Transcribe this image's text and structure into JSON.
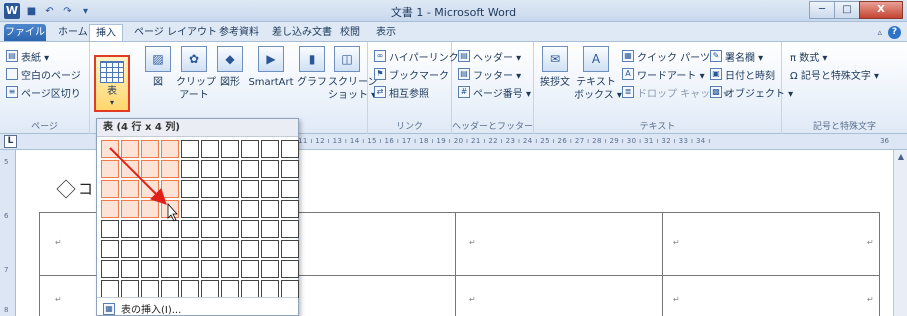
{
  "window": {
    "title": "文書 1 - Microsoft Word",
    "qat_icons": [
      "word-app-icon",
      "save-icon",
      "undo-icon",
      "redo-icon",
      "customize-qat-icon"
    ],
    "controls": [
      "─",
      "□",
      "X"
    ]
  },
  "tabs": [
    {
      "label": "ファイル"
    },
    {
      "label": "ホーム"
    },
    {
      "label": "挿入",
      "active": true
    },
    {
      "label": "ページ レイアウト"
    },
    {
      "label": "参考資料"
    },
    {
      "label": "差し込み文書"
    },
    {
      "label": "校閲"
    },
    {
      "label": "表示"
    }
  ],
  "ribbon": {
    "pages": {
      "label": "ページ",
      "items": [
        "表紙 ▾",
        "空白のページ",
        "ページ区切り"
      ]
    },
    "table": {
      "button_label": "表",
      "dropdown_caret": "▾"
    },
    "illustrations": {
      "items": [
        "図",
        "クリップ\nアート",
        "図形",
        "SmartArt",
        "グラフ",
        "スクリーン\nショット ▾"
      ]
    },
    "links": {
      "label": "リンク",
      "items": [
        "ハイパーリンク",
        "ブックマーク",
        "相互参照"
      ]
    },
    "header_footer": {
      "label": "ヘッダーとフッター",
      "items": [
        "ヘッダー ▾",
        "フッター ▾",
        "ページ番号 ▾"
      ]
    },
    "text": {
      "label": "テキスト",
      "greeting": "挨拶文",
      "textbox": "テキスト\nボックス ▾",
      "items": [
        "クイック パーツ ▾",
        "ワードアート ▾",
        "ドロップ キャップ ▾",
        "署名欄 ▾",
        "日付と時刻",
        "オブジェクト ▾"
      ]
    },
    "symbols": {
      "label": "記号と特殊文字",
      "items": [
        "π 数式 ▾",
        "Ω 記号と特殊文字 ▾"
      ]
    }
  },
  "ruler": {
    "tab_marker": "L",
    "scale_text": "11 ı 12 ı 13 ı 14 ı 15 ı 16 ı 17 ı 18 ı 19 ı 20 ı 21 ı 22 ı 23 ı 24 ı 25 ı 26 ı 27 ı 28 ı 29 ı 30 ı 31 ı 32 ı 33 ı 34 ı",
    "end_num": "36",
    "vertical_nums": [
      "5",
      "6",
      "7",
      "8"
    ]
  },
  "document": {
    "heading_text": "コ"
  },
  "table_dropdown": {
    "header": "表 (4 行 x 4 列)",
    "grid_cols": 10,
    "grid_rows": 8,
    "selected_rows": 4,
    "selected_cols": 4,
    "insert_label": "表の挿入(I)..."
  }
}
